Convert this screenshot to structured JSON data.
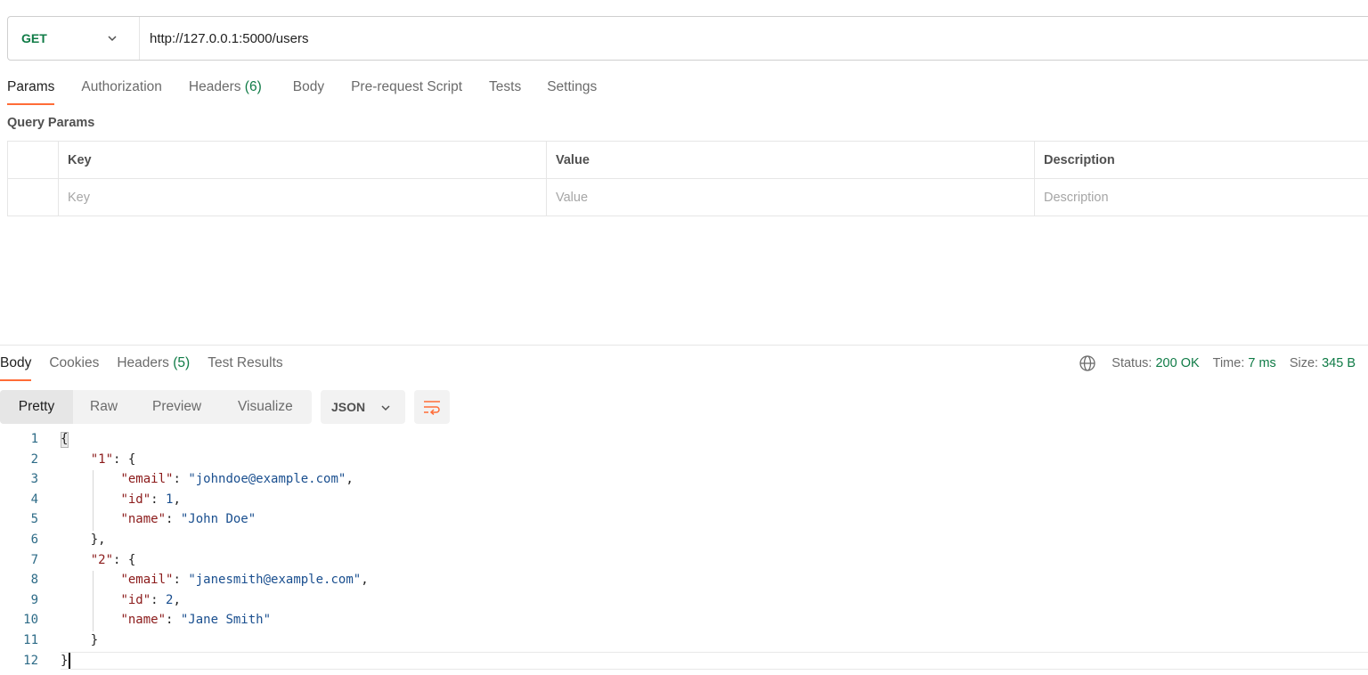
{
  "request": {
    "method": "GET",
    "url": "http://127.0.0.1:5000/users"
  },
  "request_tabs": [
    {
      "label": "Params",
      "count": ""
    },
    {
      "label": "Authorization",
      "count": ""
    },
    {
      "label": "Headers",
      "count": "(6)"
    },
    {
      "label": "Body",
      "count": ""
    },
    {
      "label": "Pre-request Script",
      "count": ""
    },
    {
      "label": "Tests",
      "count": ""
    },
    {
      "label": "Settings",
      "count": ""
    }
  ],
  "query_params": {
    "title": "Query Params",
    "headers": [
      "Key",
      "Value",
      "Description"
    ],
    "placeholders": [
      "Key",
      "Value",
      "Description"
    ]
  },
  "response_tabs": [
    {
      "label": "Body",
      "count": ""
    },
    {
      "label": "Cookies",
      "count": ""
    },
    {
      "label": "Headers",
      "count": "(5)"
    },
    {
      "label": "Test Results",
      "count": ""
    }
  ],
  "response_status": {
    "status_label": "Status:",
    "status_value": "200 OK",
    "time_label": "Time:",
    "time_value": "7 ms",
    "size_label": "Size:",
    "size_value": "345 B"
  },
  "body_toolbar": {
    "views": [
      "Pretty",
      "Raw",
      "Preview",
      "Visualize"
    ],
    "format": "JSON"
  },
  "code_lines": [
    {
      "n": "1",
      "text": "{"
    },
    {
      "n": "2",
      "text": "    \"1\": {"
    },
    {
      "n": "3",
      "text": "        \"email\": \"johndoe@example.com\","
    },
    {
      "n": "4",
      "text": "        \"id\": 1,"
    },
    {
      "n": "5",
      "text": "        \"name\": \"John Doe\""
    },
    {
      "n": "6",
      "text": "    },"
    },
    {
      "n": "7",
      "text": "    \"2\": {"
    },
    {
      "n": "8",
      "text": "        \"email\": \"janesmith@example.com\","
    },
    {
      "n": "9",
      "text": "        \"id\": 2,"
    },
    {
      "n": "10",
      "text": "        \"name\": \"Jane Smith\""
    },
    {
      "n": "11",
      "text": "    }"
    },
    {
      "n": "12",
      "text": "}"
    }
  ],
  "colors": {
    "accent": "#ff6c37",
    "status_green": "#0f7b46",
    "json_key": "#8b1a1a",
    "json_value": "#1a4f8f",
    "line_number": "#2d6b87"
  },
  "icons": {
    "method_dropdown": "chevron-down-icon",
    "format_dropdown": "chevron-down-icon",
    "network": "globe-icon",
    "wrap": "wrap-lines-icon"
  }
}
